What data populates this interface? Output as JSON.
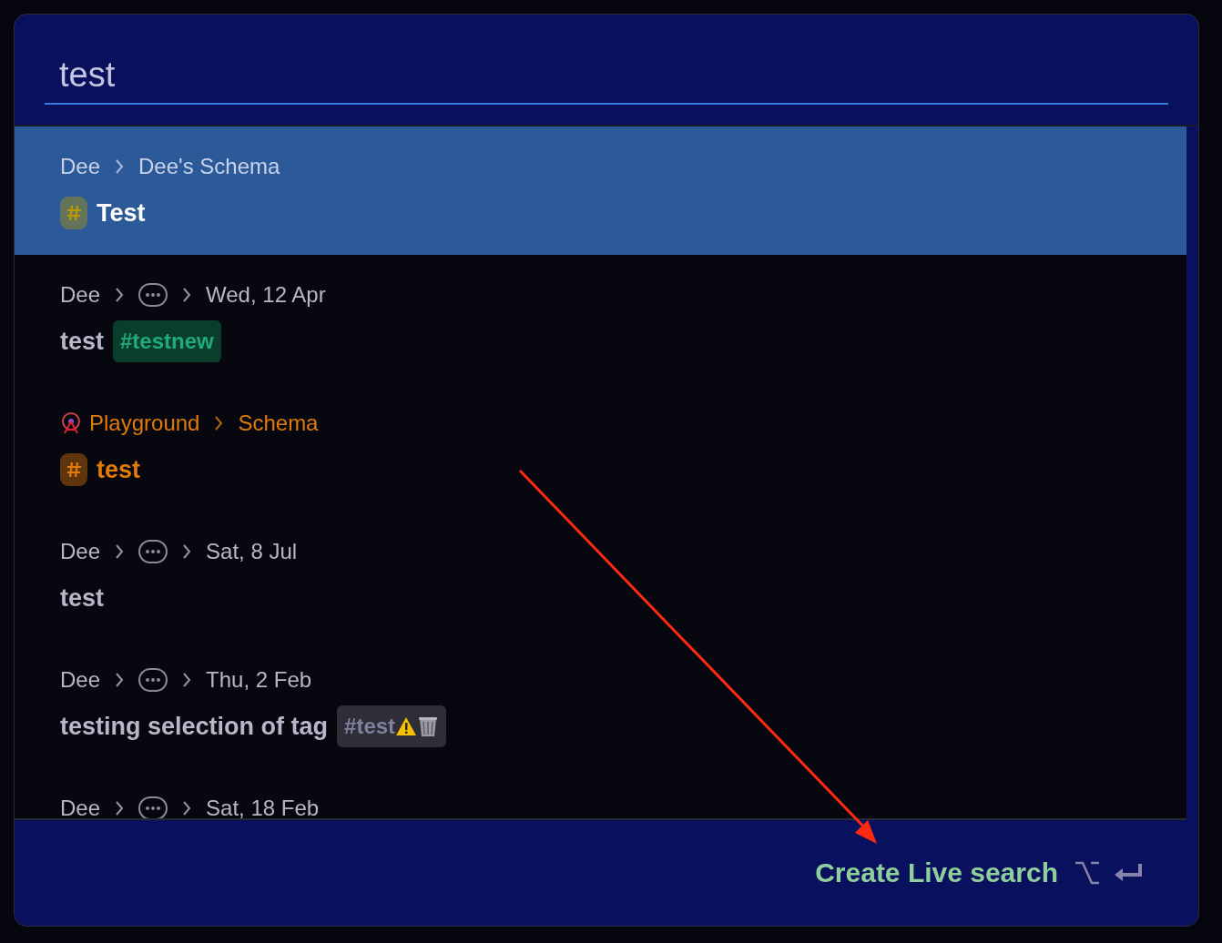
{
  "search": {
    "value": "test"
  },
  "results": [
    {
      "selected": true,
      "color": "#b89a00",
      "colored_text": false,
      "crumbs": [
        {
          "kind": "text",
          "text": "Dee"
        },
        {
          "kind": "text",
          "text": "Dee's Schema"
        }
      ],
      "hash": true,
      "title": "Test"
    },
    {
      "selected": false,
      "crumbs": [
        {
          "kind": "text",
          "text": "Dee"
        },
        {
          "kind": "more"
        },
        {
          "kind": "text",
          "text": "Wed, 12 Apr"
        }
      ],
      "hash": false,
      "title": "test",
      "tags": [
        {
          "text": "#testnew",
          "color": "#0b3d2c",
          "kind": "plain"
        }
      ]
    },
    {
      "selected": false,
      "color": "#e07a0a",
      "colored_text": true,
      "crumbs": [
        {
          "kind": "icon-text",
          "text": "Playground"
        },
        {
          "kind": "text",
          "text": "Schema"
        }
      ],
      "hash": true,
      "title": "test"
    },
    {
      "selected": false,
      "crumbs": [
        {
          "kind": "text",
          "text": "Dee"
        },
        {
          "kind": "more"
        },
        {
          "kind": "text",
          "text": "Sat, 8 Jul"
        }
      ],
      "hash": false,
      "title": "test"
    },
    {
      "selected": false,
      "crumbs": [
        {
          "kind": "text",
          "text": "Dee"
        },
        {
          "kind": "more"
        },
        {
          "kind": "text",
          "text": "Thu, 2 Feb"
        }
      ],
      "hash": false,
      "title": "testing selection of tag",
      "tags": [
        {
          "text": "#test",
          "color": "#2e2e38",
          "kind": "flagged"
        }
      ]
    },
    {
      "selected": false,
      "crumbs": [
        {
          "kind": "text",
          "text": "Dee"
        },
        {
          "kind": "more"
        },
        {
          "kind": "text",
          "text": "Sat, 18 Feb"
        }
      ],
      "hash": false
    }
  ],
  "footer": {
    "action": "Create Live search"
  }
}
